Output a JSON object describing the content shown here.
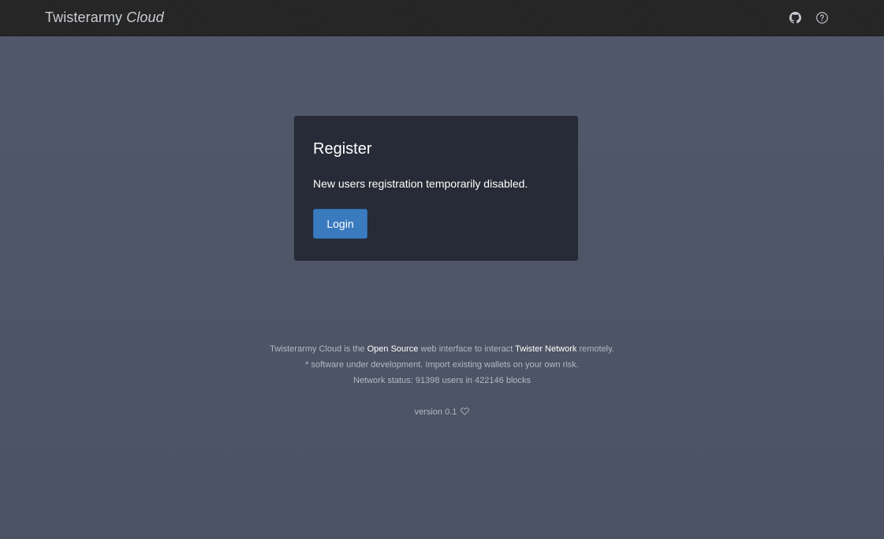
{
  "navbar": {
    "brand_main": "Twisterarmy",
    "brand_italic": "Cloud",
    "icons": [
      "github-icon",
      "help-icon"
    ]
  },
  "card": {
    "title": "Register",
    "message": "New users registration temporarily disabled.",
    "login_label": "Login"
  },
  "footer": {
    "line1_prefix": "Twisterarmy Cloud is the ",
    "line1_link1": "Open Source",
    "line1_middle": " web interface to interact ",
    "line1_link2": "Twister Network",
    "line1_suffix": " remotely.",
    "line2": "* software under development. Import existing wallets on your own risk.",
    "line3": "Network status: 91398 users in 422146 blocks",
    "version": "version 0.1",
    "heart_icon": "heart-icon"
  },
  "colors": {
    "background": "#4d5567",
    "navbar": "#262626",
    "card": "#272b37",
    "button": "#3a7bc0"
  }
}
